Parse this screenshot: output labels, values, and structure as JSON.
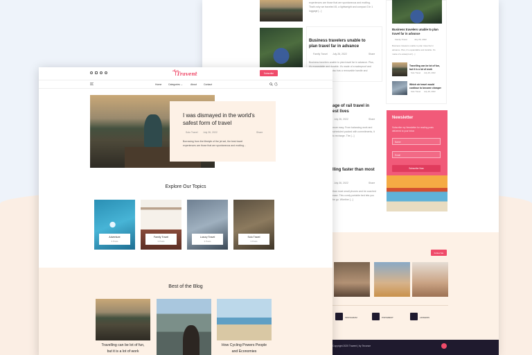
{
  "back": {
    "excerpt_top_1": "experiences are those that are spontaneous and exciting.",
    "excerpt_top_2": "That's why we traveled 45, a lightweight and compact 3 in 1",
    "excerpt_top_3": "luggage [...]",
    "post1": {
      "title_1": "Business travelers unable to",
      "title_2": "plan travel far in advance",
      "author": "Family Travel",
      "date": "July 26, 2022",
      "share": "Share",
      "excerpt_1": "Business travelers unable to plan travel far in advance. Plus,",
      "excerpt_2": "it's expandable and durable. It's made of a waterproof and",
      "excerpt_3": "dustproof material. It also has a removable handle and"
    },
    "post2": {
      "title_1": "age of rail travel in",
      "title_2": "est lives",
      "date": "July 26, 2022",
      "share": "Share",
      "excerpt_1": "more easy. From balancing work and",
      "excerpt_2": "scheduled packed with commitments, it",
      "excerpt_3": "to recharge. The [...]"
    },
    "post3": {
      "title_1": "lling faster than most",
      "date": "July 26, 2022",
      "share": "Share",
      "excerpt_1": "than most small phones and be coached",
      "excerpt_2": "ease. This comfy portable bed lets you",
      "excerpt_3": "be go. Whether [...]"
    },
    "side_feature": {
      "title_1": "Business travelers unable to plan",
      "title_2": "travel far in advance",
      "author": "Family Travel",
      "date": "July 26, 2022",
      "excerpt_1": "Business travelers unable to plan travel far in",
      "excerpt_2": "advance. Plus, it's expandable and durable. It's",
      "excerpt_3": "made of a waterproof [...]"
    },
    "side_small_1": {
      "title_1": "Travelling can be lot of fun,",
      "title_2": "but it is a lot of work",
      "author": "Solo Travel",
      "date": "July 26, 2022"
    },
    "side_small_2": {
      "title_1": "Which air travel would",
      "title_2": "continue to become cheaper",
      "author": "Solo Travel",
      "date": "July 26, 2022"
    },
    "newsletter": {
      "title": "Newsletter",
      "text_1": "Subscribe my Newsletter for reading posts",
      "text_2": "delivered to your inbox",
      "name_placeholder": "Name",
      "email_placeholder": "Email",
      "subscribe": "Subscribe Now"
    },
    "follow_label": "Follow Me",
    "socials": [
      "INSTAGRAM",
      "PINTEREST",
      "LINKEDIN"
    ],
    "copyright": "Copyright 2020 Travent | by Teconce"
  },
  "front": {
    "brand": "Travent",
    "subscribe": "Subscribe",
    "nav": {
      "home": "Home",
      "categories": "Categories",
      "about": "About",
      "contact": "Contact"
    },
    "hero": {
      "title_1": "I was dismayed in the world's",
      "title_2": "safest form of travel",
      "author": "Solo Travel",
      "date": "July 26, 2022",
      "share": "Share",
      "excerpt_1": "Borrowing from the lifestyle of the jet set, the best travel",
      "excerpt_2": "experiences are those that are spontaneous and exciting..."
    },
    "topics_title": "Explore Our Topics",
    "topics": [
      {
        "name": "Adventure",
        "count": "3 Posts"
      },
      {
        "name": "Family Travel",
        "count": "3 Posts"
      },
      {
        "name": "Luxury Travel",
        "count": "3 Posts"
      },
      {
        "name": "Solo Travel",
        "count": "3 Posts"
      }
    ],
    "blog_title": "Best of the Blog",
    "blog": [
      {
        "title_1": "Travelling can be lot of fun,",
        "title_2": "but it is a lot of work"
      },
      {
        "title_1": "",
        "title_2": ""
      },
      {
        "title_1": "How Cycling Powers People",
        "title_2": "and Economies"
      }
    ]
  },
  "colors": {
    "accent": "#ef4b6a",
    "newsletter": "#f15a79",
    "peach": "#fdf1e6",
    "footer": "#1f1a2e"
  }
}
